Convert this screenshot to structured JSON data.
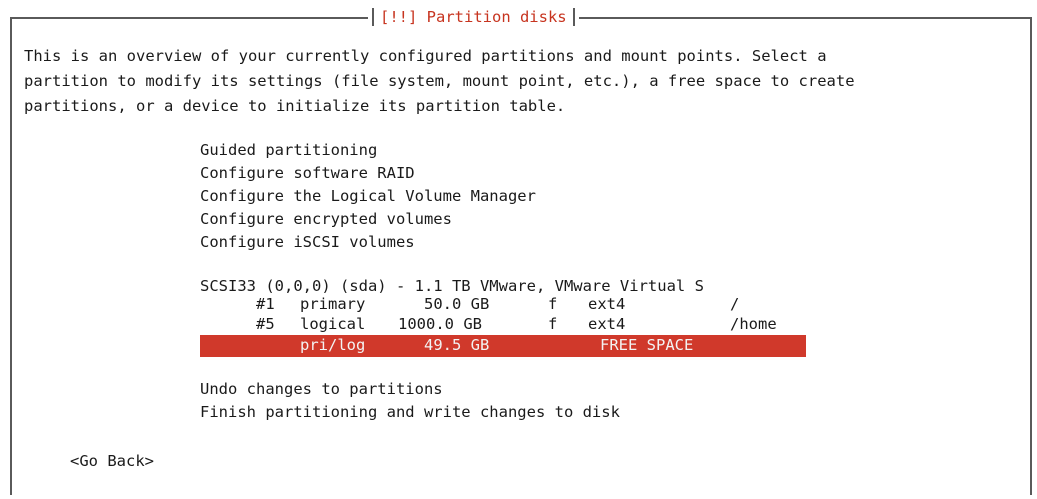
{
  "dialog": {
    "title": "[!!] Partition disks"
  },
  "intro": {
    "line1": "This is an overview of your currently configured partitions and mount points. Select a",
    "line2": "partition to modify its settings (file system, mount point, etc.), a free space to create",
    "line3": "partitions, or a device to initialize its partition table."
  },
  "menu": {
    "guided": "Guided partitioning",
    "raid": "Configure software RAID",
    "lvm": "Configure the Logical Volume Manager",
    "encrypted": "Configure encrypted volumes",
    "iscsi": "Configure iSCSI volumes"
  },
  "disk": {
    "label": "SCSI33 (0,0,0) (sda) - 1.1 TB VMware, VMware Virtual S",
    "partitions": [
      {
        "num": "#1",
        "type": "primary",
        "size": "50.0 GB",
        "flag": "f",
        "fs": "ext4",
        "mount": "/"
      },
      {
        "num": "#5",
        "type": "logical",
        "size": "1000.0 GB",
        "flag": "f",
        "fs": "ext4",
        "mount": "/home"
      },
      {
        "num": "",
        "type": "pri/log",
        "size": "49.5 GB",
        "flag": "",
        "fs": "FREE SPACE",
        "mount": ""
      }
    ]
  },
  "actions": {
    "undo": "Undo changes to partitions",
    "finish": "Finish partitioning and write changes to disk",
    "back": "<Go Back>"
  },
  "colors": {
    "selection": "#d0392b",
    "title": "#c7341f"
  }
}
